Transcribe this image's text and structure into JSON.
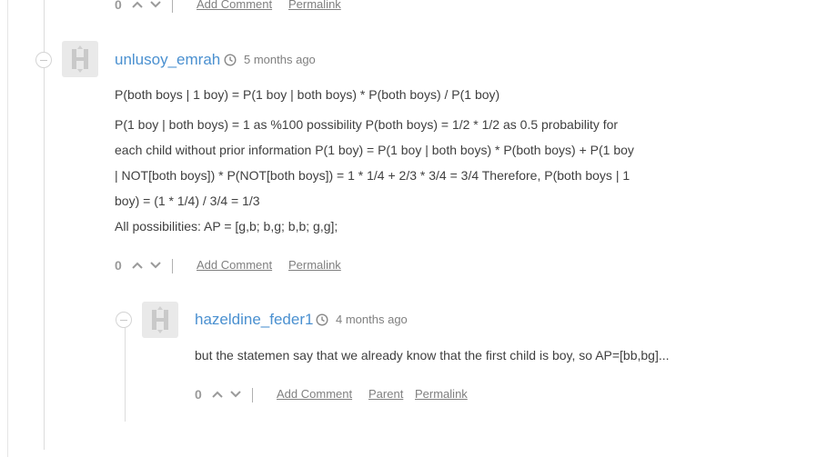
{
  "top_actions": {
    "votes": "0",
    "add_comment": "Add Comment",
    "permalink": "Permalink"
  },
  "comment1": {
    "author": "unlusoy_emrah",
    "time": "5 months ago",
    "paragraph1": "P(both boys | 1 boy) = P(1 boy | both boys) * P(both boys) / P(1 boy)",
    "paragraph2_lines": [
      "P(1 boy | both boys) = 1 as %100 possibility P(both boys) = 1/2 * 1/2 as 0.5 probability for",
      "each child without prior information P(1 boy) = P(1 boy | both boys) * P(both boys) + P(1 boy",
      "| NOT[both boys]) * P(NOT[both boys]) = 1 * 1/4 + 2/3 * 3/4 = 3/4 Therefore, P(both boys | 1",
      "boy) = (1 * 1/4) / 3/4 = 1/3"
    ],
    "paragraph3": "All possibilities: AP = [g,b; b,g; b,b; g,g];",
    "actions": {
      "votes": "0",
      "add_comment": "Add Comment",
      "permalink": "Permalink"
    }
  },
  "comment2": {
    "author": "hazeldine_feder1",
    "time": "4 months ago",
    "text": "but the statemen say that we already know that the first child is boy, so AP=[bb,bg]...",
    "actions": {
      "votes": "0",
      "add_comment": "Add Comment",
      "parent": "Parent",
      "permalink": "Permalink"
    }
  },
  "icons": {
    "avatar": "letter-h-avatar-icon",
    "clock": "clock-icon",
    "up": "chevron-up-icon",
    "down": "chevron-down-icon",
    "collapse": "collapse-minus-icon"
  },
  "colors": {
    "author_link": "#4a90d0",
    "meta_text": "#808080",
    "thread_line": "#dcdcdc"
  }
}
